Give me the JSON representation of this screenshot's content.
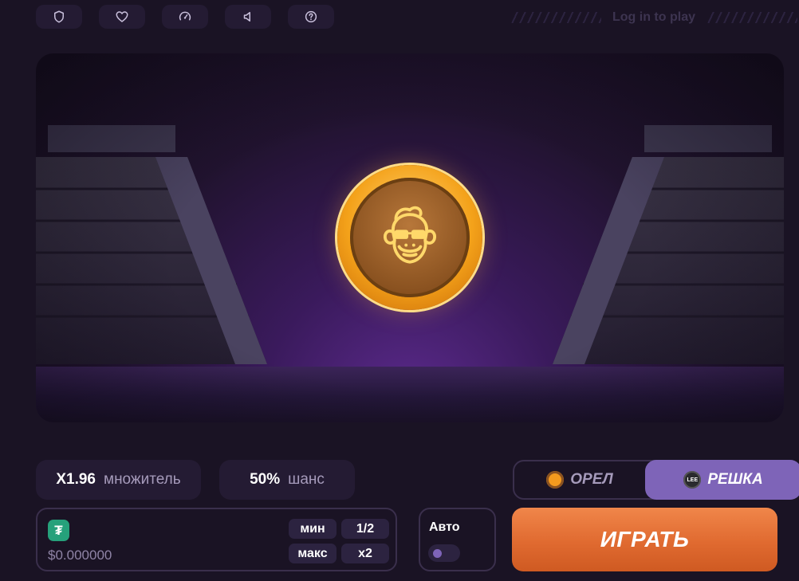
{
  "topbar": {
    "icons": [
      "shield-icon",
      "heart-icon",
      "speedometer-icon",
      "speaker-icon",
      "help-icon"
    ],
    "login_text": "Log in to play"
  },
  "stage": {
    "coin_face": "monkey-icon"
  },
  "stats": {
    "multiplier_value": "X1.96",
    "multiplier_label": "множитель",
    "chance_value": "50%",
    "chance_label": "шанс"
  },
  "side": {
    "eagle_label": "ОРЕЛ",
    "tails_label": "РЕШКА",
    "tails_coin_text": "LEE",
    "selected": "tails"
  },
  "bet": {
    "currency_symbol": "₮",
    "amount": "$0.000000",
    "min_label": "мин",
    "half_label": "1/2",
    "max_label": "макс",
    "double_label": "x2"
  },
  "auto": {
    "label": "Авто",
    "enabled": false
  },
  "play": {
    "label": "ИГРАТЬ"
  },
  "colors": {
    "background": "#1a1324",
    "panel": "#241b33",
    "accent_purple": "#7e64b8",
    "play_orange": "#e06a30",
    "usdt_green": "#26a17b",
    "coin_gold": "#f4a21a"
  }
}
